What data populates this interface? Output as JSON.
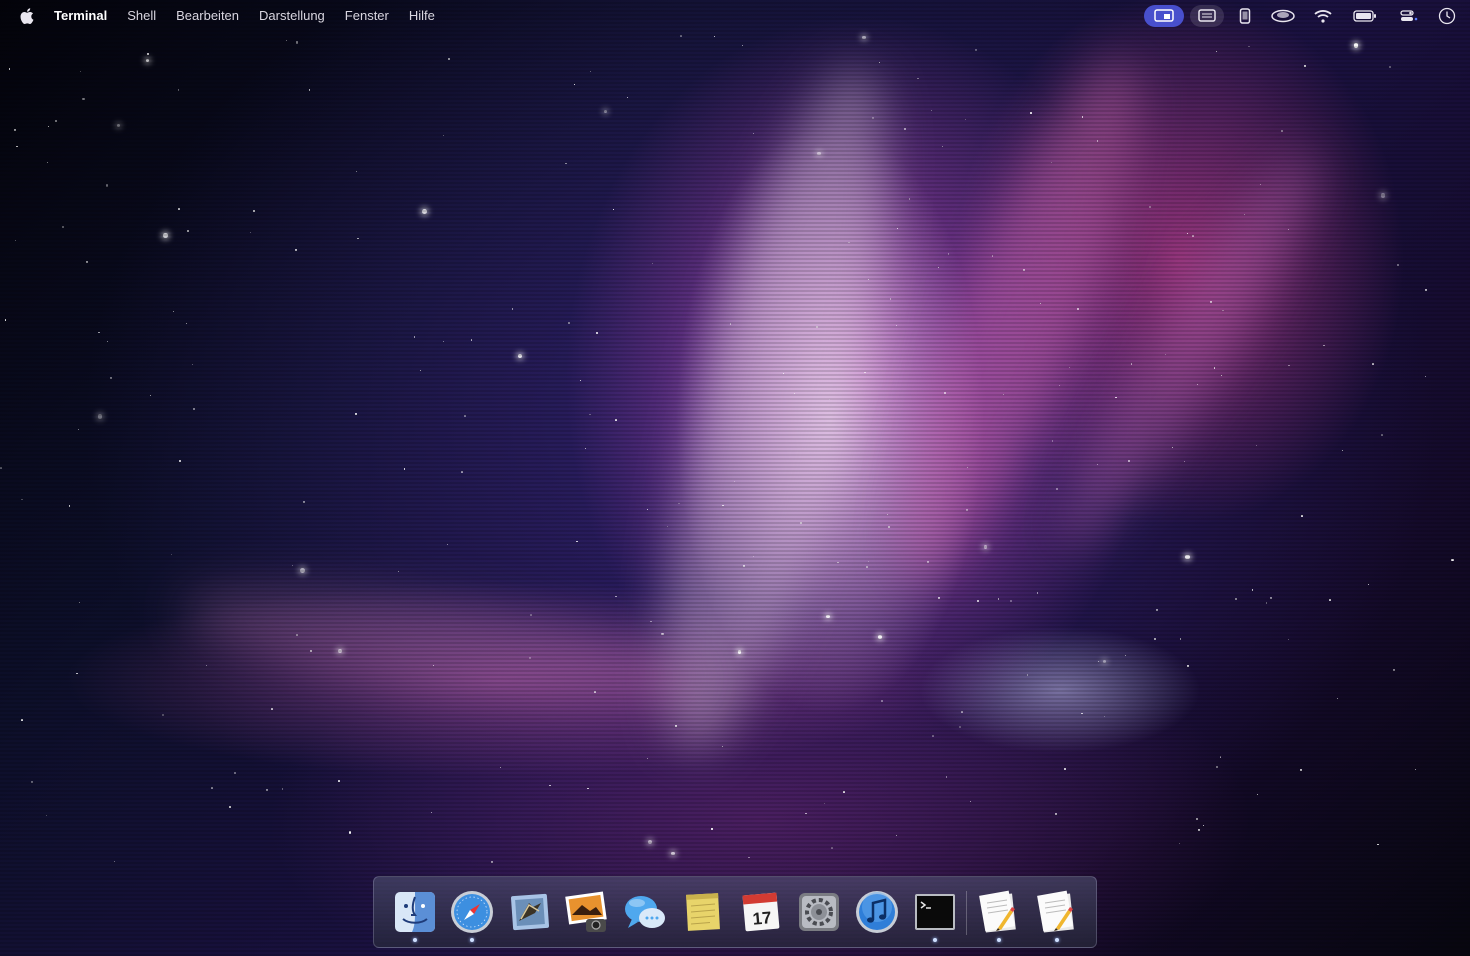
{
  "menubar": {
    "apple_icon": "apple-logo-icon",
    "app_name": "Terminal",
    "menus": [
      "Shell",
      "Bearbeiten",
      "Darstellung",
      "Fenster",
      "Hilfe"
    ],
    "status_icons": [
      "display-mirroring-icon",
      "screen-icon",
      "phone-icon",
      "cloud-sync-icon",
      "wifi-icon",
      "battery-icon",
      "control-center-icon",
      "clock-icon"
    ]
  },
  "dock": {
    "apps": [
      {
        "name": "finder-icon",
        "running": true
      },
      {
        "name": "safari-icon",
        "running": true
      },
      {
        "name": "mail-icon",
        "running": false
      },
      {
        "name": "iphoto-icon",
        "running": false
      },
      {
        "name": "ichat-icon",
        "running": false
      },
      {
        "name": "stickies-icon",
        "running": false
      },
      {
        "name": "ical-icon",
        "running": false
      },
      {
        "name": "system-preferences-icon",
        "running": false
      },
      {
        "name": "itunes-icon",
        "running": false
      },
      {
        "name": "terminal-icon",
        "running": true
      },
      {
        "name": "textedit-icon",
        "running": true
      },
      {
        "name": "textedit-icon",
        "running": true
      }
    ],
    "calendar_day": "17"
  },
  "colors": {
    "menubar_text": "#d8d5df",
    "highlight": "#5058e6",
    "running_dot": "#cfe0ff"
  }
}
